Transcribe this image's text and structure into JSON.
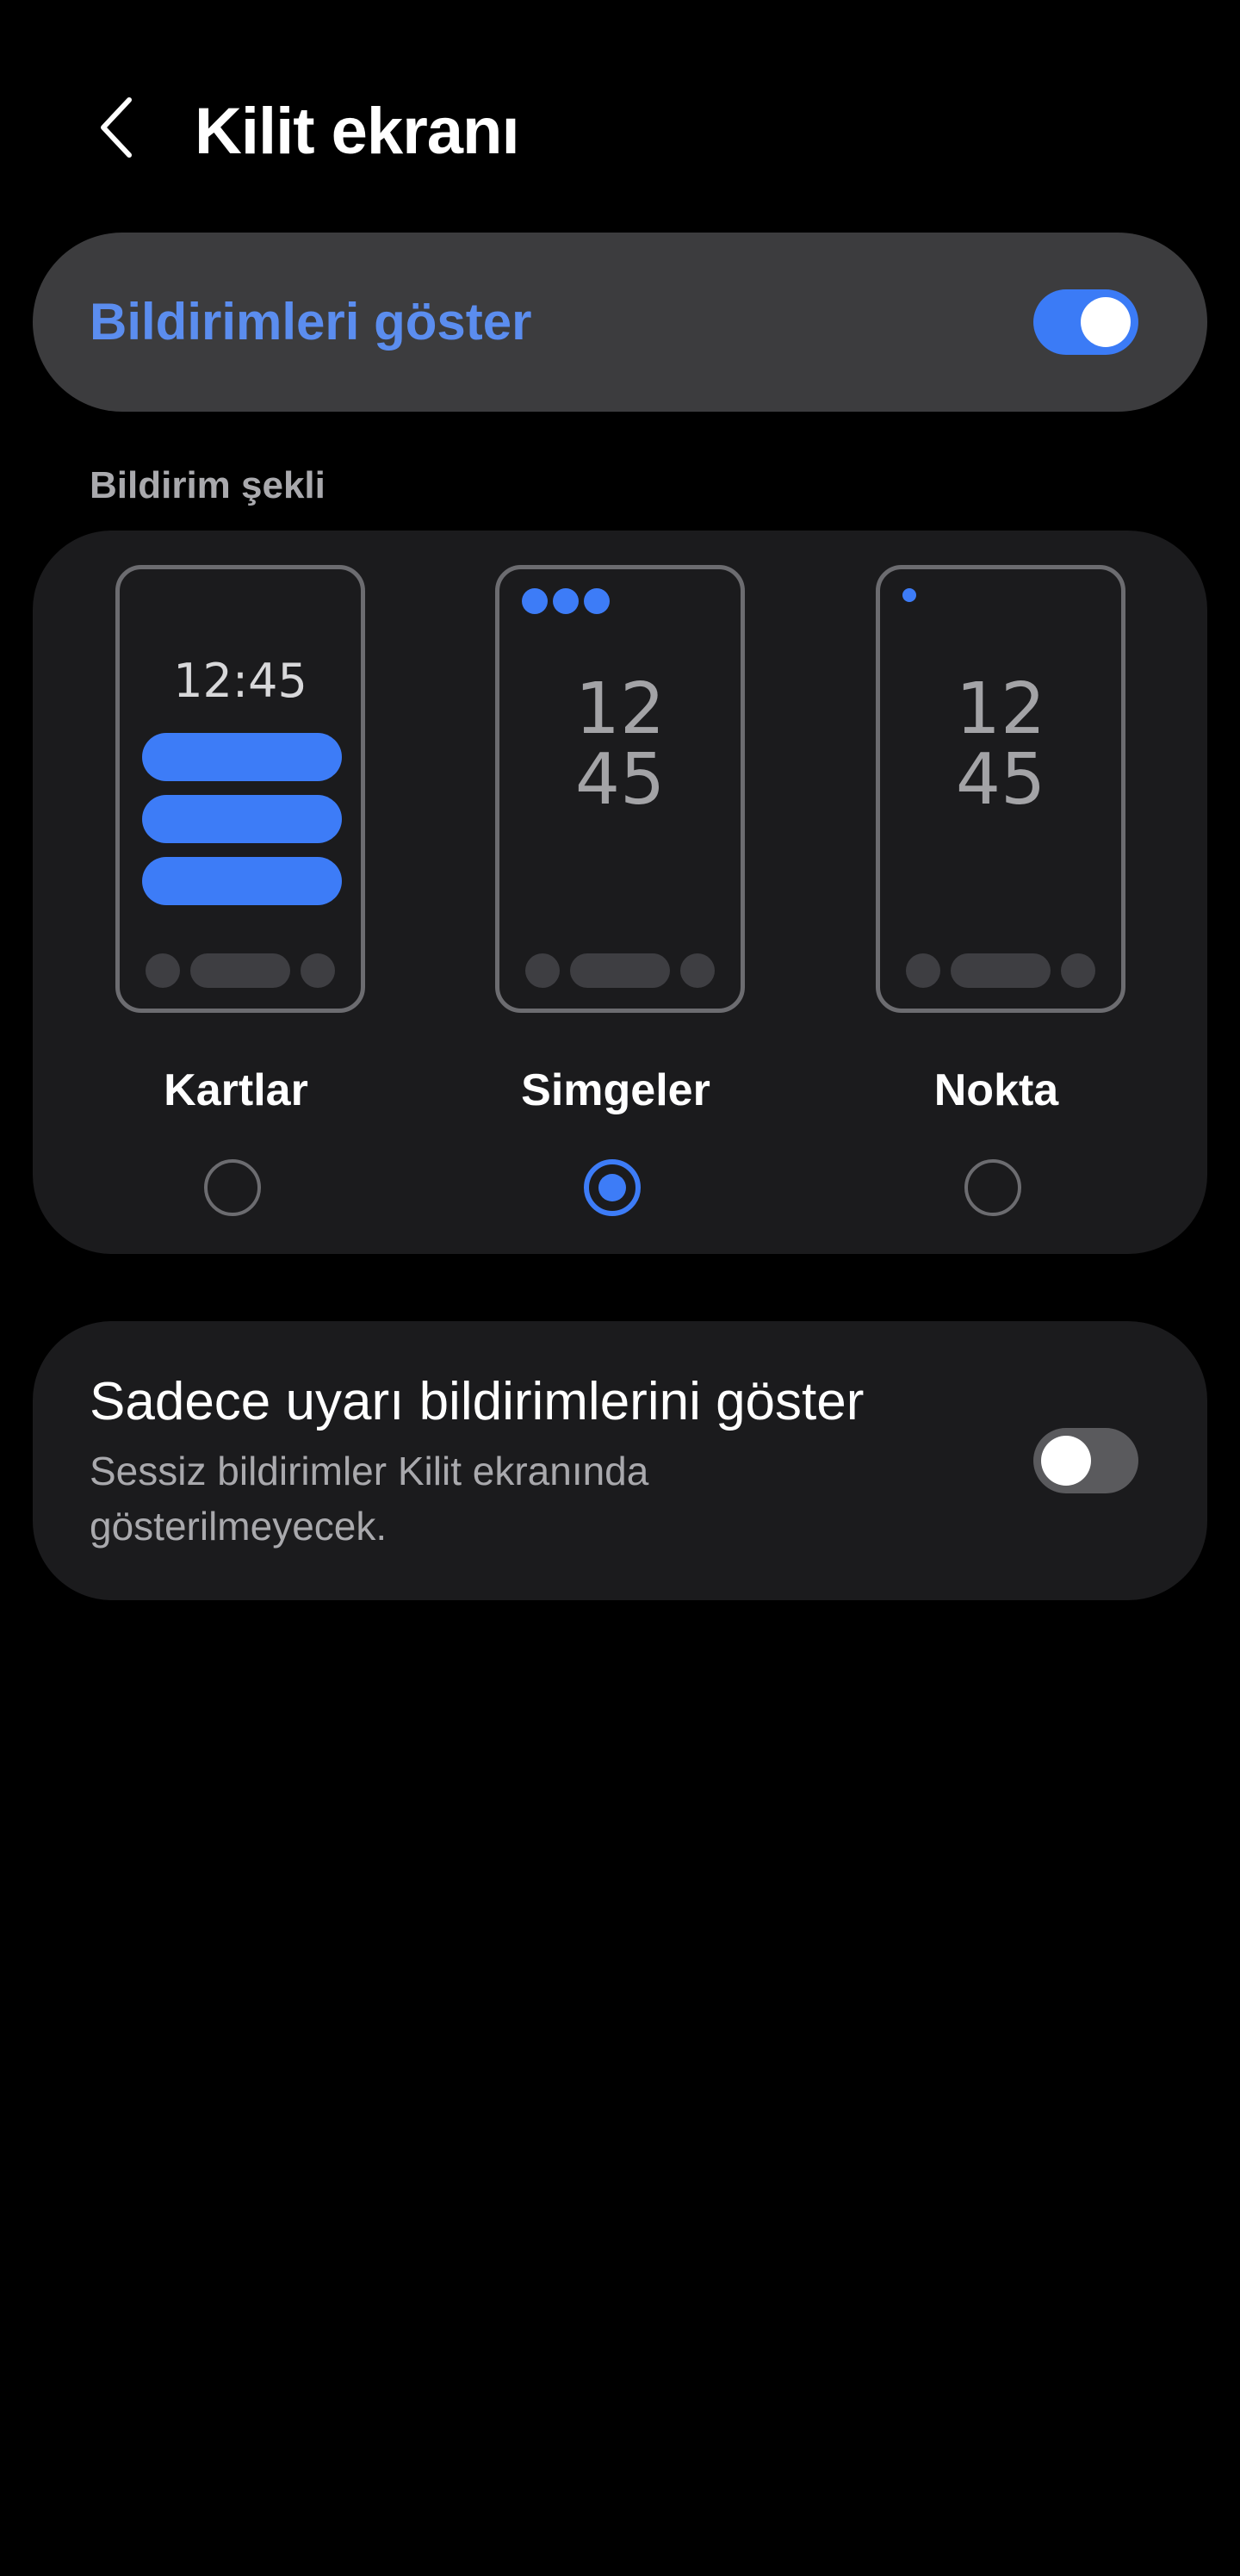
{
  "header": {
    "title": "Kilit ekranı",
    "back_icon": "chevron-left-icon"
  },
  "show_notifications": {
    "label": "Bildirimleri göster",
    "enabled": true
  },
  "notification_style": {
    "section_title": "Bildirim şekli",
    "selected": "Simgeler",
    "options": [
      {
        "label": "Kartlar",
        "preview_clock": "12:45",
        "selected": false
      },
      {
        "label": "Simgeler",
        "preview_clock_hour": "12",
        "preview_clock_minute": "45",
        "selected": true
      },
      {
        "label": "Nokta",
        "preview_clock_hour": "12",
        "preview_clock_minute": "45",
        "selected": false
      }
    ]
  },
  "alert_only": {
    "title": "Sadece uyarı bildirimlerini göster",
    "subtitle": "Sessiz bildirimler Kilit ekranında gösterilmeyecek.",
    "enabled": false
  },
  "colors": {
    "accent": "#3b7bf6",
    "accent_text": "#5b8def",
    "background": "#000000",
    "card": "#1b1b1d",
    "card_highlight": "#3c3c3e"
  }
}
